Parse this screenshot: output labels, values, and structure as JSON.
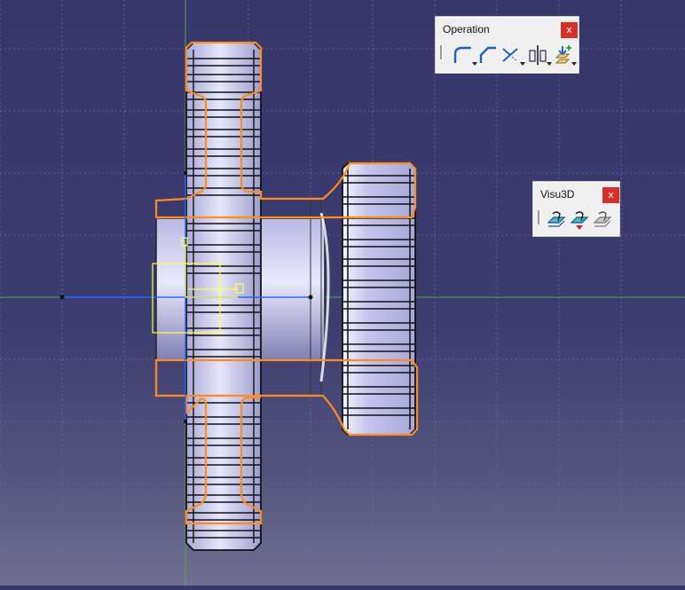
{
  "viewport": {
    "background_top": "#36376a",
    "background_bottom": "#6f7092",
    "grid_color": "#6a6b9a",
    "part_fill": "#c9c9ee",
    "highlight_color": "#ff8a1e",
    "sketch_color": "#ffff44",
    "axis_color": "#2a66ff"
  },
  "operation_toolbar": {
    "title": "Operation",
    "close_label": "x",
    "buttons": [
      {
        "name": "corner-icon"
      },
      {
        "name": "chamfer-icon"
      },
      {
        "name": "trim-icon"
      },
      {
        "name": "mirror-icon"
      },
      {
        "name": "project-3d-elements-icon"
      }
    ]
  },
  "visu3d_toolbar": {
    "title": "Visu3D",
    "close_label": "x",
    "buttons": [
      {
        "name": "cut-part-by-sketch-plane-icon"
      },
      {
        "name": "lighting-icon"
      },
      {
        "name": "no-3d-background-icon"
      }
    ]
  }
}
